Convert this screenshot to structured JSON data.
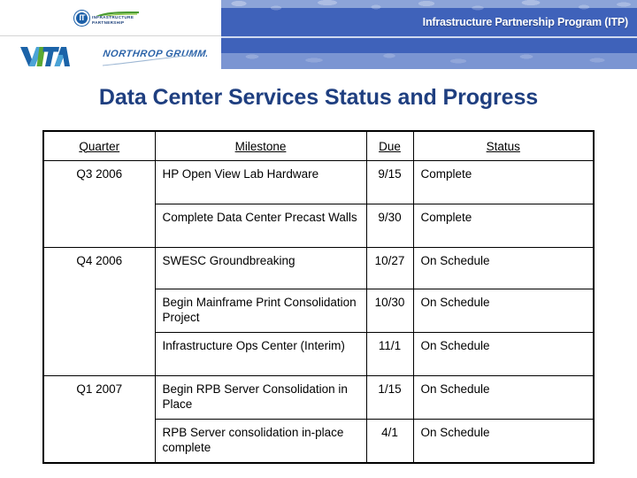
{
  "header": {
    "banner_title": "Infrastructure Partnership Program (ITP)",
    "ip_logo": {
      "badge_text": "IT",
      "line1": "INFRASTRUCTURE",
      "line2": "PARTNERSHIP"
    },
    "vita_logo_text": "VITA",
    "northrop_logo_text": "NORTHROP GRUMMAN",
    "colors": {
      "banner_blue": "#3f62ba",
      "banner_light_blue": "#8ca4d8",
      "title_navy": "#1f3f80",
      "vita_blue": "#1b63a8",
      "vita_green": "#5aa832"
    }
  },
  "slide": {
    "title": "Data Center Services Status and Progress"
  },
  "table": {
    "columns": [
      "Quarter",
      "Milestone",
      "Due",
      "Status"
    ],
    "groups": [
      {
        "quarter": "Q3 2006",
        "rows": [
          {
            "milestone": "HP Open View Lab Hardware",
            "due": "9/15",
            "status": "Complete"
          },
          {
            "milestone": "Complete Data Center Precast Walls",
            "due": "9/30",
            "status": "Complete"
          }
        ]
      },
      {
        "quarter": "Q4 2006",
        "rows": [
          {
            "milestone": "SWESC Groundbreaking",
            "due": "10/27",
            "status": "On Schedule"
          },
          {
            "milestone": "Begin Mainframe Print Consolidation Project",
            "due": "10/30",
            "status": "On Schedule"
          },
          {
            "milestone": "Infrastructure Ops Center (Interim)",
            "due": "11/1",
            "status": "On Schedule"
          }
        ]
      },
      {
        "quarter": "Q1 2007",
        "rows": [
          {
            "milestone": "Begin RPB Server Consolidation in Place",
            "due": "1/15",
            "status": "On Schedule"
          },
          {
            "milestone": "RPB Server consolidation in-place complete",
            "due": "4/1",
            "status": "On Schedule"
          }
        ]
      }
    ]
  }
}
